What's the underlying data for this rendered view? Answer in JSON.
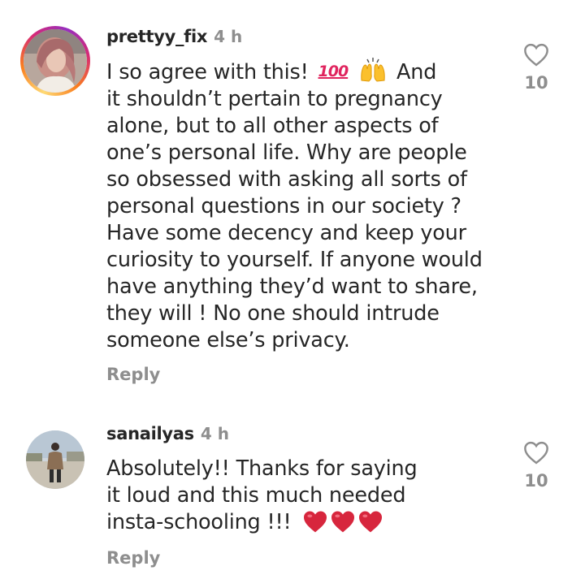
{
  "comments": [
    {
      "username": "prettyy_fix",
      "time": "4 h",
      "lines": [
        "I so agree with this!",
        "it shouldn’t pertain to pregnancy",
        "alone, but to all other aspects of",
        "one’s personal life. Why are people",
        "so obsessed with asking all sorts of",
        "personal questions in our society ?",
        "Have some decency and keep your",
        "curiosity to yourself. If anyone would",
        "have anything they’d want to share,",
        "they will ! No one should intrude",
        "someone else’s privacy."
      ],
      "first_line_tail": "And",
      "emojis": [
        "hundred-points-emoji",
        "raising-hands-emoji"
      ],
      "emoji_100_text": "100",
      "reply_label": "Reply",
      "likes": "10",
      "has_story_ring": true
    },
    {
      "username": "sanailyas",
      "time": "4 h",
      "lines": [
        "Absolutely!! Thanks for saying",
        "it loud and this much needed",
        "insta-schooling !!!"
      ],
      "emojis": [
        "red-heart-emoji",
        "red-heart-emoji",
        "red-heart-emoji"
      ],
      "reply_label": "Reply",
      "likes": "10",
      "has_story_ring": false
    }
  ],
  "colors": {
    "text": "#262626",
    "muted": "#8e8e8e",
    "heart_red": "#e0245e"
  }
}
